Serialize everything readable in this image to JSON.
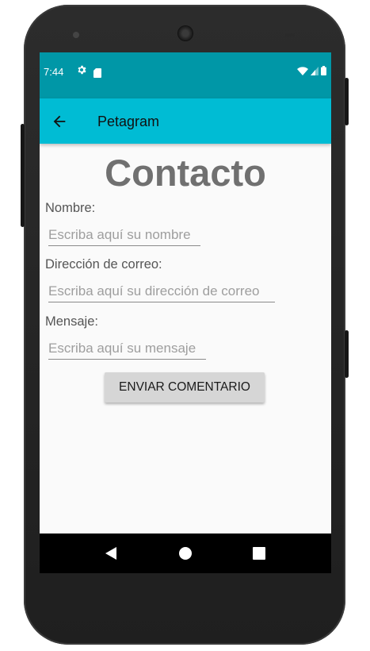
{
  "status_bar": {
    "time": "7:44"
  },
  "app_bar": {
    "title": "Petagram"
  },
  "form": {
    "heading": "Contacto",
    "name_label": "Nombre:",
    "name_placeholder": "Escriba aquí su nombre",
    "email_label": "Dirección de correo:",
    "email_placeholder": "Escriba aquí su dirección de correo",
    "message_label": "Mensaje:",
    "message_placeholder": "Escriba aquí su mensaje",
    "submit_label": "ENVIAR COMENTARIO"
  },
  "colors": {
    "status_bar": "#0097a7",
    "app_bar": "#00bcd4",
    "background": "#fafafa",
    "button": "#d6d6d6",
    "heading": "#707070"
  },
  "icons": {
    "status": [
      "gear-icon",
      "sd-card-icon",
      "wifi-icon",
      "signal-icon",
      "battery-icon"
    ],
    "app_bar": "back-arrow-icon",
    "nav": [
      "back-triangle-icon",
      "home-circle-icon",
      "recents-square-icon"
    ]
  }
}
